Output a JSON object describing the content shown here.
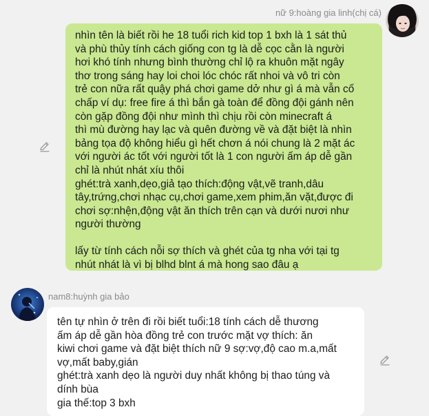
{
  "messages": [
    {
      "sender": "nữ 9:hoàng gia linh(chị cá)",
      "direction": "outgoing",
      "avatar_icon": "girl-avatar-icon",
      "action_icon": "edit-icon",
      "bubble_color": "#c9e891",
      "paragraphs": [
        "nhìn tên là biết rồi he 18 tuổi rich kid top 1 bxh là 1 sát thủ\nvà phù thủy tính cách giống con tg là dễ cọc cằn là người\nhơi khó tính nhưng bình thường chỉ lộ ra khuôn mặt ngây\nthơ trong sáng hay loi choi lóc chóc rất nhoi và vô tri còn\ntrẻ con nữa rất quậy phá chơi game dở như gì á mà vẫn cố\nchấp ví dụ: free fire á thì bắn gà toàn để đồng đội gánh nên\ncòn gặp đồng đội như mình thì chịu rồi còn minecraft á\nthì mù đường hay lạc và quên đường về và đặt biệt là nhìn\nbảng tọa độ không hiểu gì hết chơn á nói chung là 2 mặt ác\nvới người ác tốt với người tốt là 1 con người ấm áp dễ gần\nchỉ là nhút nhát xíu thôi",
        " ghét:trà xanh,dẹo,giả tạo thích:động vật,vẽ tranh,dâu\ntây,trứng,chơi nhạc cụ,chơi game,xem phim,ăn vặt,được đi\nchơi sợ:nhện,động vật ăn thích trên cạn và dưới nươi như\nngười thường",
        "lấy từ tính cách nỗi sợ thích và ghét của tg nha với tại tg\nnhút nhát là vì bị blhd blnt á mà hong sao đâu ạ"
      ]
    },
    {
      "sender": "nam8:huỳnh gia bảo",
      "direction": "incoming",
      "avatar_icon": "boy-avatar-icon",
      "action_icon": "edit-icon",
      "bubble_color": "#ffffff",
      "paragraphs": [
        "tên tự nhìn ở trên đi rồi biết tuổi:18 tính cách dễ thương\nấm áp dễ gần hòa đồng trẻ con trước mặt vợ  thích: ăn\nkiwi chơi game và đặt biệt thích nữ 9 sợ:vợ,độ cao m.a,mất\nvợ,mất baby,gián\nghét:trà xanh dẹo là người duy nhất không bị thao túng và\ndính bùa\ngia thế:top 3 bxh"
      ]
    }
  ]
}
